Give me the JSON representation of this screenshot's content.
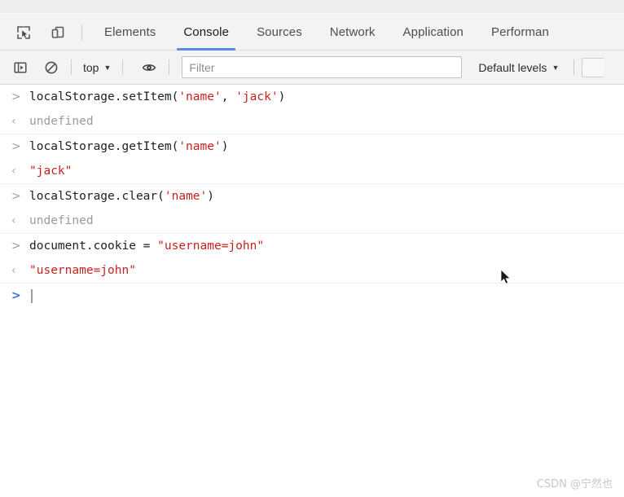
{
  "devtools": {
    "tabbar": {
      "inspect_icon": "inspect-element-icon",
      "device_icon": "device-toolbar-icon",
      "tabs": [
        {
          "label": "Elements",
          "active": false
        },
        {
          "label": "Console",
          "active": true
        },
        {
          "label": "Sources",
          "active": false
        },
        {
          "label": "Network",
          "active": false
        },
        {
          "label": "Application",
          "active": false
        },
        {
          "label": "Performan",
          "active": false
        }
      ],
      "active_tab": "Console",
      "active_underline_color": "#5b87e8"
    },
    "controlbar": {
      "sidebar_icon": "console-sidebar-icon",
      "clear_icon": "clear-console-icon",
      "context_label": "top",
      "context_caret": "▼",
      "eye_icon": "live-expression-eye-icon",
      "filter_placeholder": "Filter",
      "filter_value": "",
      "levels_label": "Default levels",
      "levels_caret": "▼"
    },
    "console": {
      "input_marker": ">",
      "output_marker": "‹",
      "prompt_marker": ">",
      "entries": [
        {
          "input_code": "localStorage.setItem(",
          "input_parts": [
            {
              "text": "localStorage.setItem(",
              "kind": "code"
            },
            {
              "text": "'name'",
              "kind": "string"
            },
            {
              "text": ", ",
              "kind": "code"
            },
            {
              "text": "'jack'",
              "kind": "string"
            },
            {
              "text": ")",
              "kind": "code"
            }
          ],
          "output_text": "undefined",
          "output_kind": "undefined"
        },
        {
          "input_parts": [
            {
              "text": "localStorage.getItem(",
              "kind": "code"
            },
            {
              "text": "'name'",
              "kind": "string"
            },
            {
              "text": ")",
              "kind": "code"
            }
          ],
          "output_text": "\"jack\"",
          "output_kind": "string"
        },
        {
          "input_parts": [
            {
              "text": "localStorage.clear(",
              "kind": "code"
            },
            {
              "text": "'name'",
              "kind": "string"
            },
            {
              "text": ")",
              "kind": "code"
            }
          ],
          "output_text": "undefined",
          "output_kind": "undefined"
        },
        {
          "input_parts": [
            {
              "text": "document.cookie = ",
              "kind": "code"
            },
            {
              "text": "\"username=john\"",
              "kind": "string"
            }
          ],
          "output_text": "\"username=john\"",
          "output_kind": "string"
        }
      ],
      "current_input_value": ""
    },
    "watermark": "CSDN @宁然也",
    "colors": {
      "accent": "#5b87e8",
      "string": "#c5221f",
      "code": "#202124",
      "undefined": "#9b9b9b",
      "toolbar_bg": "#f3f3f3"
    }
  }
}
